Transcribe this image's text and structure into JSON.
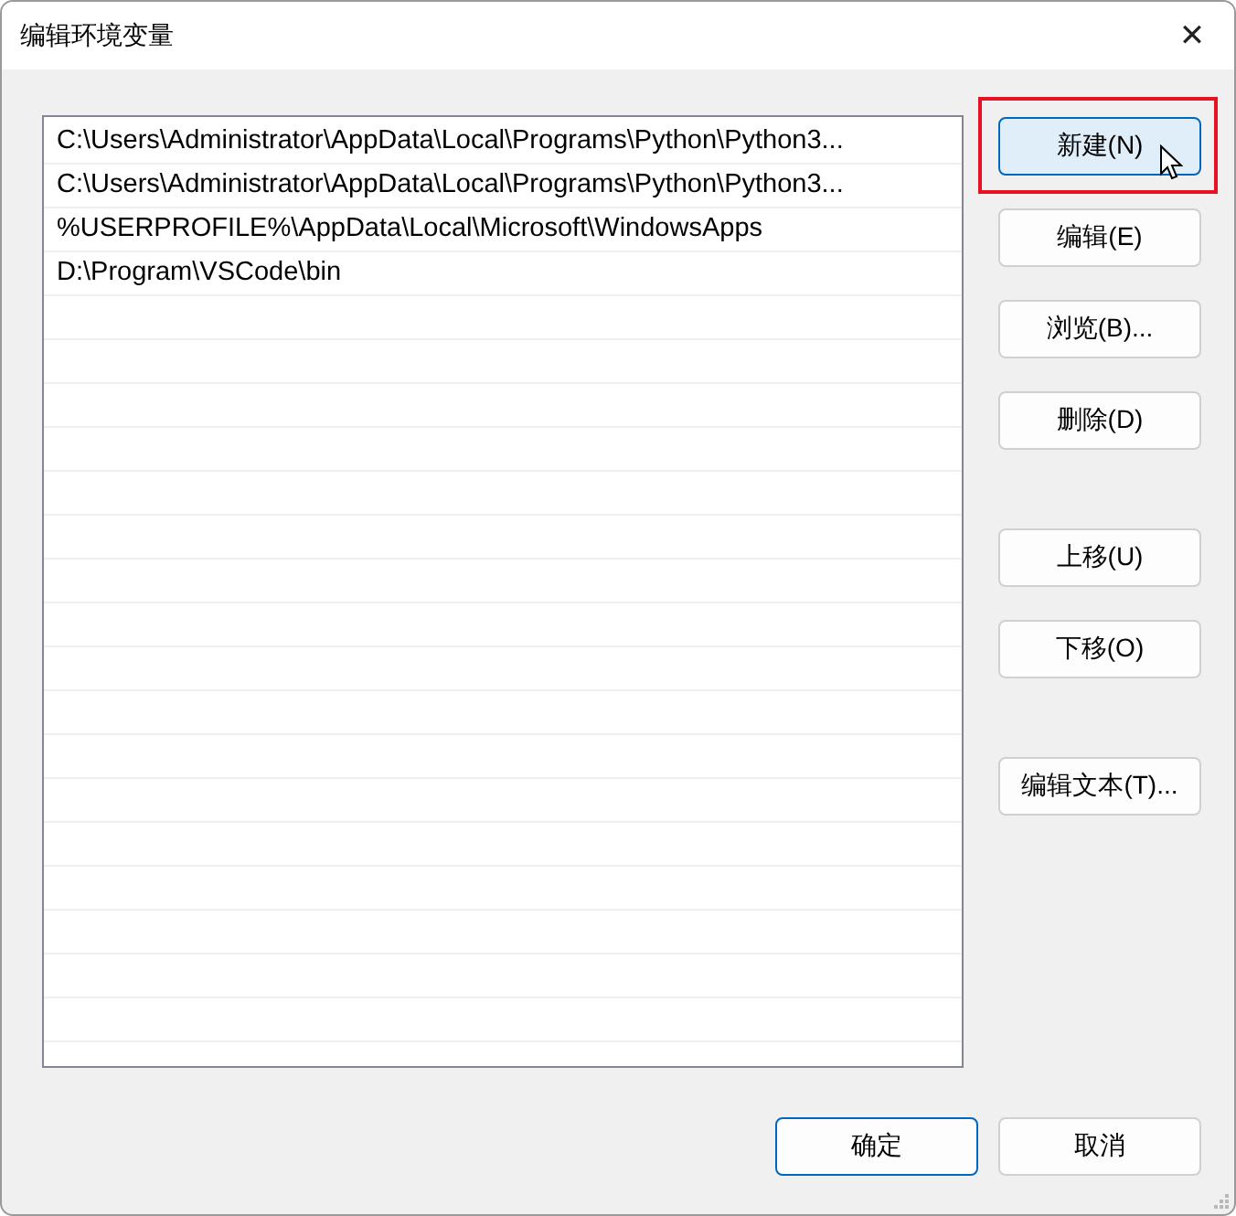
{
  "window": {
    "title": "编辑环境变量",
    "close": "✕"
  },
  "entries": [
    {
      "text": "C:\\Users\\Administrator\\AppData\\Local\\Programs\\Python\\Python3...",
      "selected": false
    },
    {
      "text": "C:\\Users\\Administrator\\AppData\\Local\\Programs\\Python\\Python3...",
      "selected": false
    },
    {
      "text": "%USERPROFILE%\\AppData\\Local\\Microsoft\\WindowsApps",
      "selected": false
    },
    {
      "text": "D:\\Program\\VSCode\\bin",
      "selected": false
    }
  ],
  "side_button_groups": [
    [
      {
        "label": "新建(N)",
        "hovered": true,
        "highlighted": true
      },
      {
        "label": "编辑(E)",
        "hovered": false,
        "highlighted": false
      },
      {
        "label": "浏览(B)...",
        "hovered": false,
        "highlighted": false
      },
      {
        "label": "删除(D)",
        "hovered": false,
        "highlighted": false
      }
    ],
    [
      {
        "label": "上移(U)",
        "hovered": false,
        "highlighted": false
      },
      {
        "label": "下移(O)",
        "hovered": false,
        "highlighted": false
      }
    ],
    [
      {
        "label": "编辑文本(T)...",
        "hovered": false,
        "highlighted": false
      }
    ]
  ],
  "dialog_buttons": [
    {
      "label": "确定",
      "default": true
    },
    {
      "label": "取消",
      "default": false
    }
  ]
}
